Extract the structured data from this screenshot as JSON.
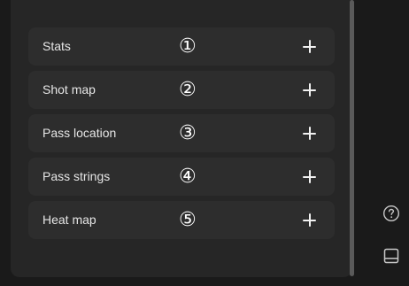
{
  "items": [
    {
      "label": "Stats",
      "number": "①"
    },
    {
      "label": "Shot map",
      "number": "②"
    },
    {
      "label": "Pass location",
      "number": "③"
    },
    {
      "label": "Pass strings",
      "number": "④"
    },
    {
      "label": "Heat map",
      "number": "⑤"
    }
  ],
  "icons": {
    "add": "plus-icon",
    "help": "help-circle-icon",
    "panel": "panel-layout-icon"
  },
  "colors": {
    "background": "#1a1a1a",
    "panel": "#262626",
    "row": "#2d2d2d",
    "text": "#e6e6e6",
    "scrollbar": "#5a5a5a"
  }
}
